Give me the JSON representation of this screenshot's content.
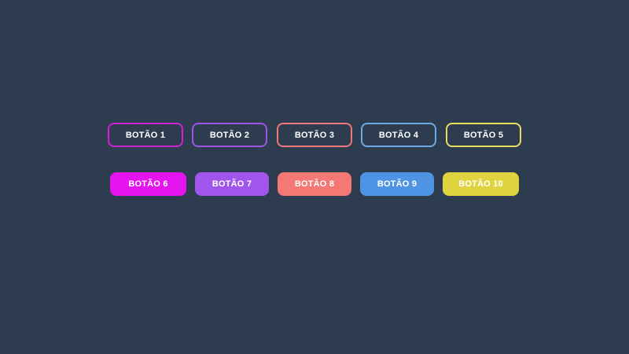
{
  "outline_buttons": [
    {
      "label": "BOTÃO 1",
      "color": "#d21fd8"
    },
    {
      "label": "BOTÃO 2",
      "color": "#9b55e8"
    },
    {
      "label": "BOTÃO 3",
      "color": "#ee7777"
    },
    {
      "label": "BOTÃO 4",
      "color": "#6aaae8"
    },
    {
      "label": "BOTÃO 5",
      "color": "#e6df5c"
    }
  ],
  "filled_buttons": [
    {
      "label": "BOTÃO 6",
      "color": "#e414ee"
    },
    {
      "label": "BOTÃO 7",
      "color": "#a155ec"
    },
    {
      "label": "BOTÃO 8",
      "color": "#f47873"
    },
    {
      "label": "BOTÃO 9",
      "color": "#4f93e4"
    },
    {
      "label": "BOTÃO 10",
      "color": "#dfd43f"
    }
  ]
}
